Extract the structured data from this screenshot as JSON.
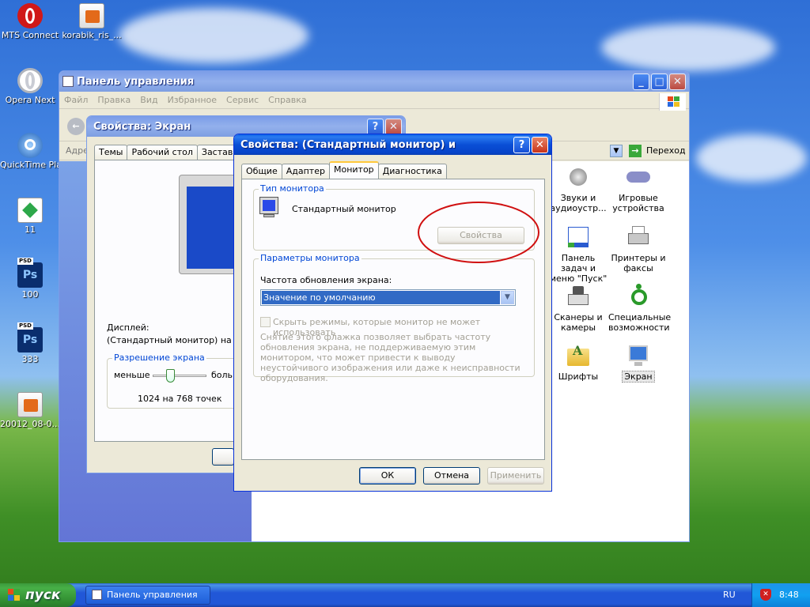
{
  "desktop": {
    "icons": [
      {
        "label": "MTS Connect"
      },
      {
        "label": "korabik_ris_..."
      },
      {
        "label": "Opera Next"
      },
      {
        "label": "QuickTime Player"
      },
      {
        "label": "11"
      },
      {
        "label": "100",
        "badge": "PSD",
        "glyph": "Ps"
      },
      {
        "label": "333",
        "badge": "PSD",
        "glyph": "Ps"
      },
      {
        "label": "20012_08-0..."
      }
    ]
  },
  "control_panel": {
    "title": "Панель управления",
    "menu": [
      "Файл",
      "Правка",
      "Вид",
      "Избранное",
      "Сервис",
      "Справка"
    ],
    "address_label": "Адре",
    "go_label": "Переход",
    "items": [
      {
        "label": "Звуки и аудиоустр...",
        "icon": "speaker-icon"
      },
      {
        "label": "Игровые устройства",
        "icon": "gamepad-icon"
      },
      {
        "label": "Панель задач и меню \"Пуск\"",
        "icon": "taskbar-icon"
      },
      {
        "label": "Принтеры и факсы",
        "icon": "printer-icon"
      },
      {
        "label": "Сканеры и камеры",
        "icon": "scanner-icon"
      },
      {
        "label": "Специальные возможности",
        "icon": "accessibility-icon"
      },
      {
        "label": "Шрифты",
        "icon": "fonts-folder-icon"
      },
      {
        "label": "Экран",
        "icon": "display-icon"
      }
    ]
  },
  "display_props": {
    "title": "Свойства: Экран",
    "tabs": [
      "Темы",
      "Рабочий стол",
      "Заставка"
    ],
    "display_label": "Дисплей:",
    "display_value": "(Стандартный монитор) на",
    "resolution_group": "Разрешение экрана",
    "less": "меньше",
    "more": "больш",
    "resolution_value": "1024 на 768 точек",
    "resolution_level": 0.33
  },
  "monitor_dialog": {
    "title": "Свойства: (Стандартный монитор) и",
    "tabs": [
      "Общие",
      "Адаптер",
      "Монитор",
      "Диагностика"
    ],
    "active_tab": "Монитор",
    "monitor_type_group": "Тип монитора",
    "monitor_name": "Стандартный монитор",
    "properties_button": "Свойства",
    "settings_group": "Параметры монитора",
    "refresh_label": "Частота обновления экрана:",
    "refresh_value": "Значение по умолчанию",
    "hide_modes_label": "Скрыть режимы, которые монитор не может использовать",
    "warning_text": "Снятие этого флажка позволяет выбрать частоту обновления экрана, не поддерживаемую этим монитором, что может привести к выводу неустойчивого изображения или даже к неисправности оборудования.",
    "ok": "ОК",
    "cancel": "Отмена",
    "apply": "Применить"
  },
  "annotation": {
    "color": "#d01010"
  },
  "taskbar": {
    "start": "пуск",
    "task": "Панель управления",
    "lang": "RU",
    "clock": "8:48"
  },
  "colors": {
    "xp_blue": "#0a4fd6",
    "dialog_face": "#ece9d8",
    "selection": "#316ac5"
  }
}
